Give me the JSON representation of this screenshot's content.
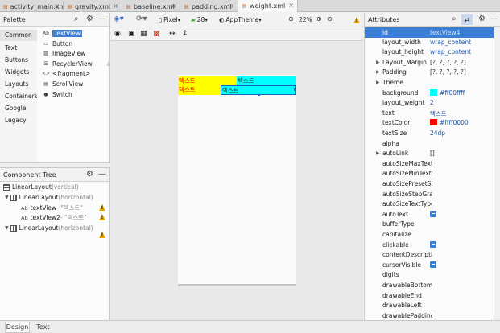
{
  "tabs": [
    {
      "label": "activity_main.xml",
      "active": false
    },
    {
      "label": "gravity.xml",
      "active": false
    },
    {
      "label": "baseline.xml",
      "active": false
    },
    {
      "label": "padding.xml",
      "active": false
    },
    {
      "label": "weight.xml",
      "active": true
    }
  ],
  "palette": {
    "title": "Palette",
    "categories": [
      "Common",
      "Text",
      "Buttons",
      "Widgets",
      "Layouts",
      "Containers",
      "Google",
      "Legacy"
    ],
    "selected_category": "Common",
    "items": [
      {
        "icon": "Ab",
        "label": "TextView"
      },
      {
        "icon": "▭",
        "label": "Button"
      },
      {
        "icon": "▧",
        "label": "ImageView"
      },
      {
        "icon": "☰",
        "label": "RecyclerView"
      },
      {
        "icon": "<>",
        "label": "<fragment>"
      },
      {
        "icon": "▤",
        "label": "ScrollView"
      },
      {
        "icon": "●",
        "label": "Switch"
      }
    ]
  },
  "component_tree": {
    "title": "Component Tree",
    "nodes": [
      {
        "label": "LinearLayout",
        "detail": "(vertical)"
      },
      {
        "label": "LinearLayout",
        "detail": "(horizontal)"
      },
      {
        "label": "textView",
        "detail": "- \"텍스트\""
      },
      {
        "label": "textView2",
        "detail": "- \"텍스트\""
      },
      {
        "label": "LinearLayout",
        "detail": "(horizontal)"
      }
    ]
  },
  "toolbar": {
    "device": "Pixel",
    "api": "28",
    "theme": "AppTheme",
    "zoom": "22%"
  },
  "preview": {
    "row1": [
      "텍스트",
      "텍스트"
    ],
    "row2": [
      "텍스트",
      "텍스트"
    ]
  },
  "attributes": {
    "title": "Attributes",
    "id_label": "id",
    "id_value": "textView4",
    "rows": [
      {
        "name": "layout_width",
        "value": "wrap_content"
      },
      {
        "name": "layout_height",
        "value": "wrap_content"
      },
      {
        "name": "Layout_Margin",
        "value": "[?, ?, ?, ?, ?]",
        "expandable": true,
        "muted": true
      },
      {
        "name": "Padding",
        "value": "[?, ?, ?, ?, ?]",
        "expandable": true,
        "muted": true
      },
      {
        "name": "Theme",
        "value": "",
        "expandable": true
      },
      {
        "name": "background",
        "value": "#ff00ffff",
        "swatch": "#00ffff"
      },
      {
        "name": "layout_weight",
        "value": "2"
      },
      {
        "name": "text",
        "value": "텍스트"
      },
      {
        "name": "textColor",
        "value": "#ffff0000",
        "swatch": "#ff0000"
      },
      {
        "name": "textSize",
        "value": "24dp"
      },
      {
        "name": "alpha",
        "value": ""
      },
      {
        "name": "autoLink",
        "value": "[]",
        "expandable": true,
        "muted": true
      },
      {
        "name": "autoSizeMaxTextSize",
        "value": ""
      },
      {
        "name": "autoSizeMinTextSize",
        "value": ""
      },
      {
        "name": "autoSizePresetSizes",
        "value": ""
      },
      {
        "name": "autoSizeStepGranularity",
        "value": ""
      },
      {
        "name": "autoSizeTextType",
        "value": ""
      },
      {
        "name": "autoText",
        "value": "",
        "check": true
      },
      {
        "name": "bufferType",
        "value": ""
      },
      {
        "name": "capitalize",
        "value": ""
      },
      {
        "name": "clickable",
        "value": "",
        "check": true
      },
      {
        "name": "contentDescription",
        "value": ""
      },
      {
        "name": "cursorVisible",
        "value": "",
        "check": true
      },
      {
        "name": "digits",
        "value": ""
      },
      {
        "name": "drawableBottom",
        "value": ""
      },
      {
        "name": "drawableEnd",
        "value": ""
      },
      {
        "name": "drawableLeft",
        "value": ""
      },
      {
        "name": "drawablePadding",
        "value": ""
      }
    ]
  },
  "bottom_tabs": {
    "design": "Design",
    "text": "Text"
  },
  "colors": {
    "accent": "#3b7fd4",
    "warning": "#e8a400",
    "cyan": "#00ffff",
    "yellow": "#ffff00",
    "red": "#ff0000"
  }
}
